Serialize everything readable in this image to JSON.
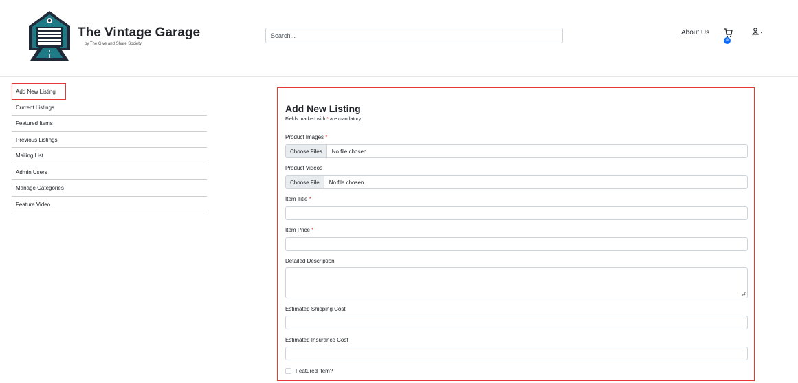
{
  "header": {
    "brand_title": "The Vintage Garage",
    "brand_subtitle": "by The Give and Share Society",
    "search_placeholder": "Search...",
    "about_label": "About Us",
    "cart_count": "0",
    "icons": {
      "logo": "garage-logo",
      "cart": "cart-icon",
      "user": "user-icon",
      "dropdown": "caret-down-icon"
    }
  },
  "sidebar": {
    "items": [
      {
        "label": "Add New Listing",
        "active": true
      },
      {
        "label": "Current Listings"
      },
      {
        "label": "Featured Items"
      },
      {
        "label": "Previous Listings"
      },
      {
        "label": "Mailing List"
      },
      {
        "label": "Admin Users"
      },
      {
        "label": "Manage Categories"
      },
      {
        "label": "Feature Video"
      }
    ]
  },
  "form": {
    "title": "Add New Listing",
    "note_prefix": "Fields marked with ",
    "note_star": "*",
    "note_suffix": " are mandatory.",
    "required_star": "*",
    "product_images": {
      "label": "Product Images",
      "button": "Choose Files",
      "status": "No file chosen"
    },
    "product_videos": {
      "label": "Product Videos",
      "button": "Choose File",
      "status": "No file chosen"
    },
    "item_title": {
      "label": "Item Title",
      "value": ""
    },
    "item_price": {
      "label": "Item Price",
      "value": ""
    },
    "detailed_description": {
      "label": "Detailed Description",
      "value": ""
    },
    "estimated_shipping": {
      "label": "Estimated Shipping Cost",
      "value": ""
    },
    "estimated_insurance": {
      "label": "Estimated Insurance Cost",
      "value": ""
    },
    "featured_item": {
      "label": "Featured Item?",
      "checked": false
    }
  },
  "colors": {
    "accent_red": "#e53935",
    "badge_blue": "#0d6efd",
    "logo_teal": "#1e7a85",
    "logo_dark": "#1f2937"
  }
}
